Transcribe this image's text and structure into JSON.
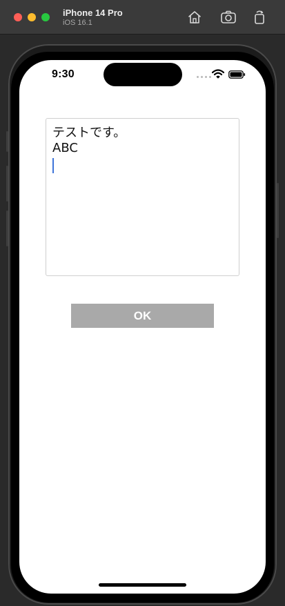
{
  "window": {
    "device_name": "iPhone 14 Pro",
    "os_version": "iOS 16.1"
  },
  "toolbar": {
    "icons": [
      "home-icon",
      "screenshot-icon",
      "rotate-icon"
    ]
  },
  "status_bar": {
    "time": "9:30"
  },
  "editor": {
    "lines": [
      "テストです。",
      "ABC"
    ],
    "caret_color": "#3d74d9"
  },
  "ok_button": {
    "label": "OK",
    "background": "#a9a9a9"
  }
}
